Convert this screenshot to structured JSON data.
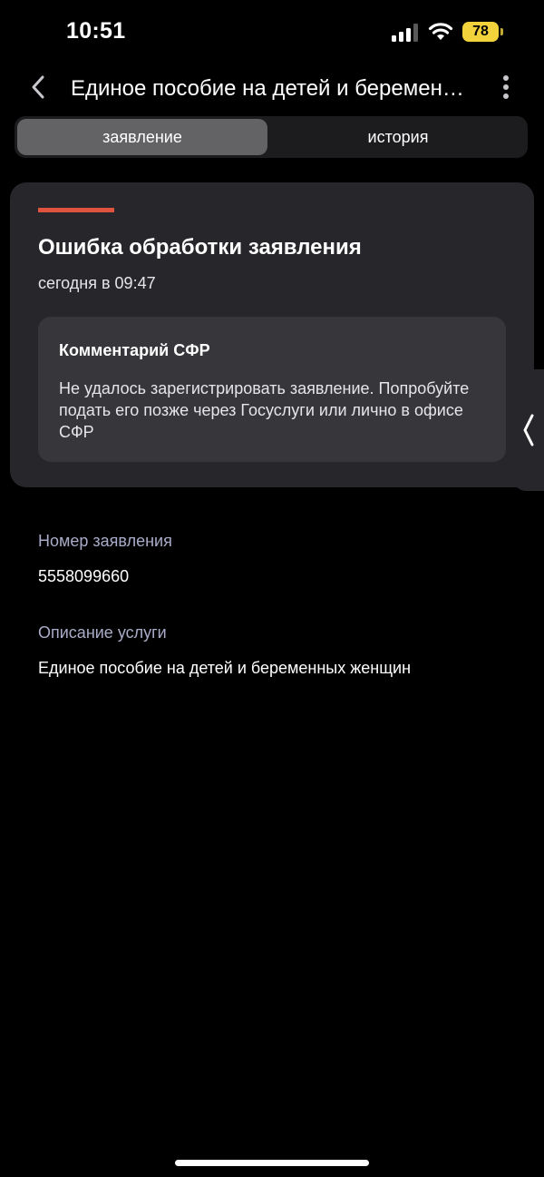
{
  "status_bar": {
    "time": "10:51",
    "battery_level": "78",
    "icons": [
      "signal-icon",
      "wifi-icon",
      "battery-icon"
    ],
    "battery_color": "#f2d33c"
  },
  "header": {
    "title": "Единое пособие на детей и беременных женщин",
    "icons": [
      "chevron-left-icon",
      "more-vertical-icon"
    ]
  },
  "tabs": [
    {
      "label": "заявление",
      "active": true
    },
    {
      "label": "история",
      "active": false
    }
  ],
  "status_card": {
    "title": "Ошибка обработки заявления",
    "date": "сегодня в 09:47",
    "accent_color": "#e0533f",
    "comment": {
      "heading": "Комментарий СФР",
      "text": "Не удалось зарегистрировать заявление. Попробуйте подать его позже через Госуслуги или лично в офисе СФР"
    }
  },
  "side_tab": {
    "icon": "chevron-left-icon"
  },
  "fields": [
    {
      "label": "Номер заявления",
      "value": "5558099660"
    },
    {
      "label": "Описание услуги",
      "value": "Единое пособие на детей и беременных женщин"
    }
  ]
}
